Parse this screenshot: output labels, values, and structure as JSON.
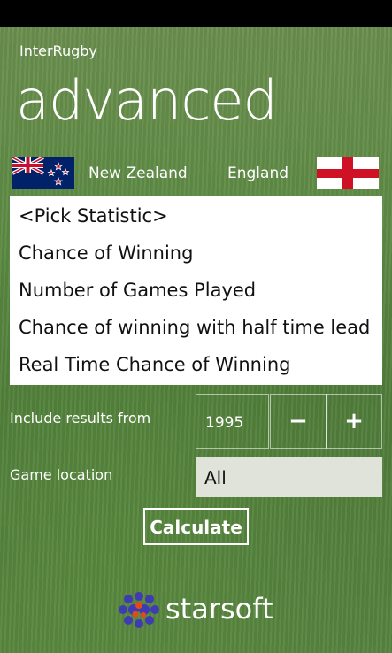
{
  "app": {
    "name": "InterRugby",
    "page_title": "advanced"
  },
  "teams": {
    "home": {
      "name": "New Zealand",
      "flag_icon": "new-zealand-flag-icon"
    },
    "away": {
      "name": "England",
      "flag_icon": "england-flag-icon"
    }
  },
  "statistics": {
    "items": [
      "<Pick Statistic>",
      "Chance of Winning",
      "Number of Games Played",
      "Chance of winning with half time lead",
      "Real Time Chance of Winning"
    ]
  },
  "results_filter": {
    "label": "Include results from",
    "year": "1995",
    "decrement_label": "−",
    "increment_label": "+"
  },
  "location_filter": {
    "label": "Game location",
    "value": "All"
  },
  "calculate_label": "Calculate",
  "brand": {
    "name": "starsoft",
    "icon": "starsoft-logo-icon"
  },
  "colors": {
    "accent_white": "#ffffff",
    "select_background": "#dfe3da",
    "flag_red": "#ce1124"
  }
}
